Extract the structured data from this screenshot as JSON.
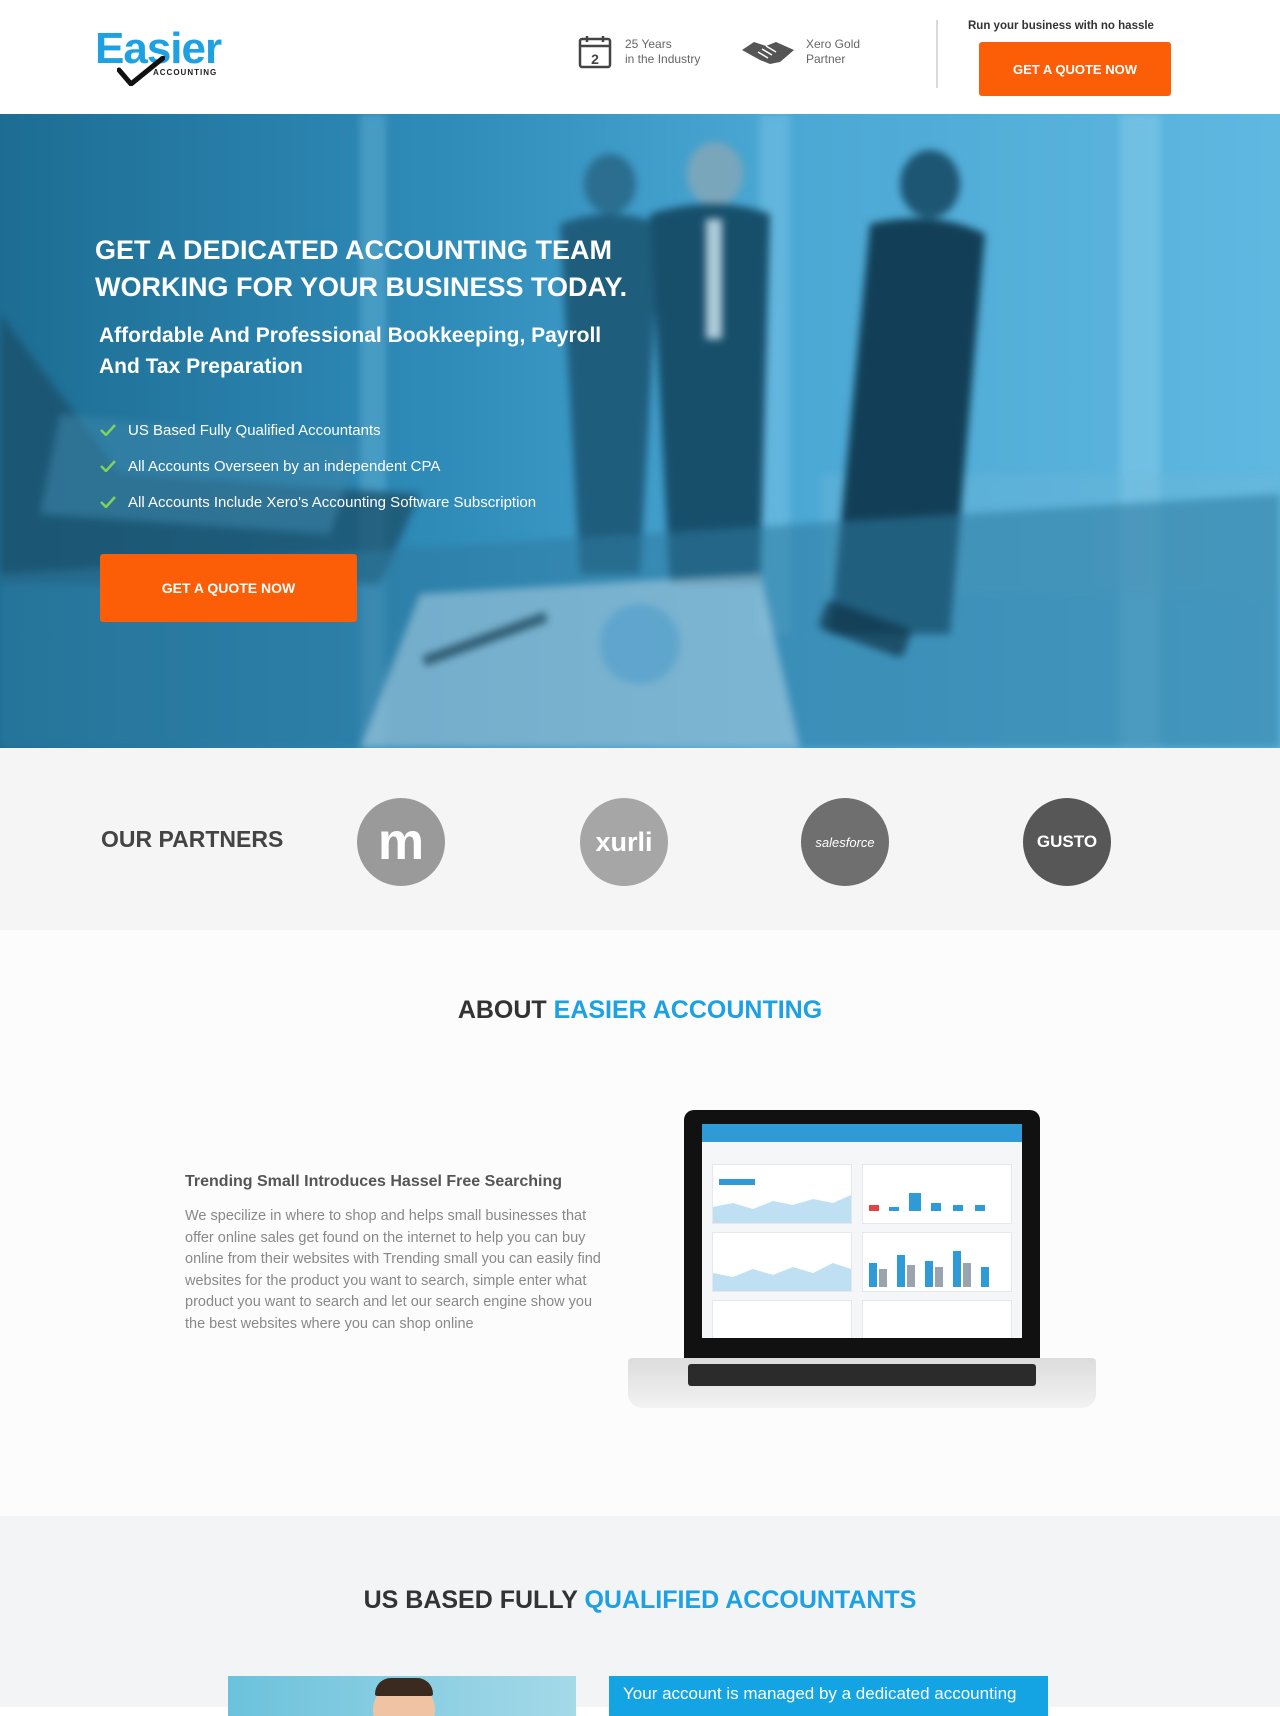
{
  "header": {
    "logo": {
      "word": "Easier",
      "sub": "ACCOUNTING"
    },
    "features": [
      {
        "icon": "calendar-icon",
        "line1": "25 Years",
        "line2": "in the Industry"
      },
      {
        "icon": "handshake-icon",
        "line1": "Xero Gold",
        "line2": "Partner"
      }
    ],
    "tagline": "Run your business with no hassle",
    "cta_label": "GET A QUOTE NOW"
  },
  "hero": {
    "title_line1": "GET A DEDICATED ACCOUNTING TEAM",
    "title_line2": "WORKING FOR YOUR BUSINESS TODAY.",
    "subtitle_line1": "Affordable And Professional Bookkeeping, Payroll",
    "subtitle_line2": "And Tax Preparation",
    "bullets": [
      "US Based Fully Qualified Accountants",
      "All Accounts Overseen by an independent CPA",
      "All Accounts Include Xero's Accounting Software Subscription"
    ],
    "cta_label": "GET A QUOTE NOW"
  },
  "partners": {
    "title": "OUR PARTNERS",
    "logos": [
      {
        "name": "m-logo",
        "text": "m"
      },
      {
        "name": "xurli-logo",
        "text": "xurli"
      },
      {
        "name": "salesforce-logo",
        "text": "salesforce"
      },
      {
        "name": "gusto-logo",
        "text": "GUSTO"
      }
    ]
  },
  "about": {
    "title_dark": "ABOUT",
    "title_blue": "EASIER ACCOUNTING",
    "subtitle": "Trending Small Introduces Hassel Free Searching",
    "body": "We specilize in where to shop and helps small businesses that offer online sales get found on the internet to help you can buy online from their websites with Trending small you can easily find websites for the product you want to search, simple enter what product you want to search and let our search engine show you the best websites where you can shop online"
  },
  "accountants": {
    "title_dark": "US BASED FULLY",
    "title_blue": "QUALIFIED ACCOUNTANTS",
    "box_text": "Your account is managed by a dedicated accounting"
  },
  "colors": {
    "brand_blue": "#1da1e2",
    "cta_orange": "#fb5e06",
    "hero_blue": "#2f8cb9"
  }
}
